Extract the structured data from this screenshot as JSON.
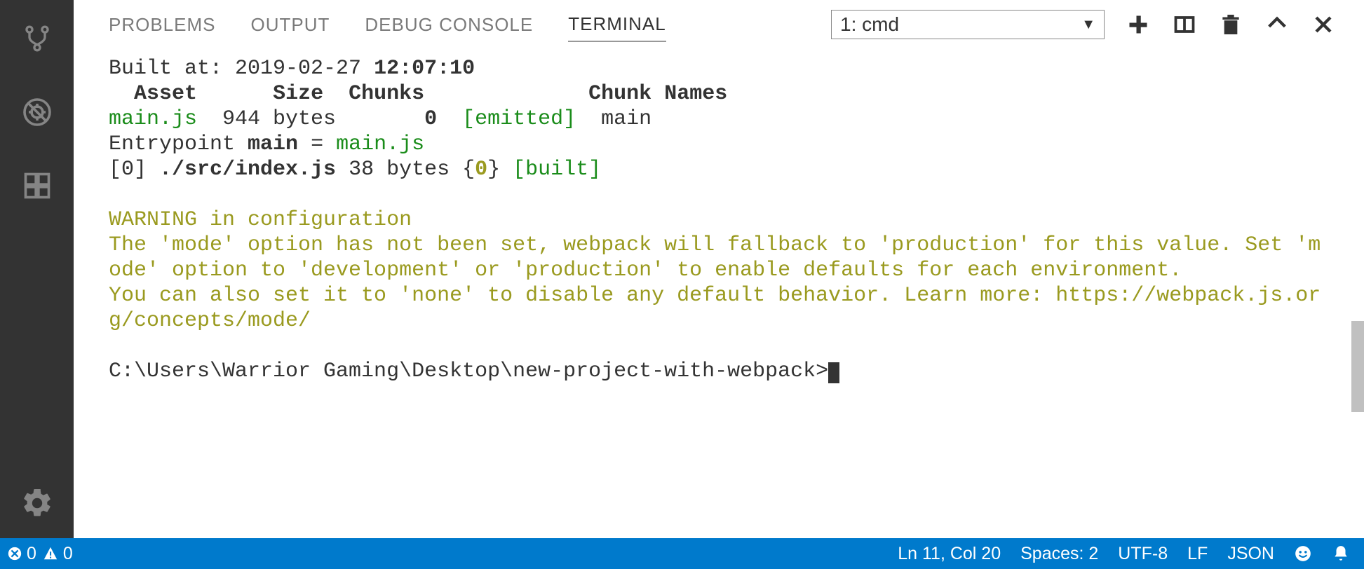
{
  "tabs": {
    "problems": "PROBLEMS",
    "output": "OUTPUT",
    "debug": "DEBUG CONSOLE",
    "terminal": "TERMINAL"
  },
  "terminalSelect": "1: cmd",
  "terminal": {
    "builtAtLabel": "Built at: 2019-02-27 ",
    "builtAtTime": "12:07:10",
    "headerAsset": "Asset",
    "headerSize": "Size",
    "headerChunks": "Chunks",
    "headerChunkNames": "Chunk Names",
    "assetName": "main.js",
    "assetSize": "  944 bytes       ",
    "assetChunk": "0",
    "assetEmitted": "[emitted]",
    "assetChunkName": "  main",
    "entryLabel": "Entrypoint ",
    "entryMain": "main",
    "entryEq": " = ",
    "entryFile": "main.js",
    "modIndex": "[0] ",
    "modFile": "./src/index.js",
    "modSize": " 38 bytes {",
    "modChunk": "0",
    "modCloseBrace": "} ",
    "modBuilt": "[built]",
    "warn1": "WARNING in configuration",
    "warn2": "The 'mode' option has not been set, webpack will fallback to 'production' for this value. Set 'mode' option to 'development' or 'production' to enable defaults for each environment.",
    "warn3": "You can also set it to 'none' to disable any default behavior. Learn more: https://webpack.js.org/concepts/mode/",
    "prompt": "C:\\Users\\Warrior Gaming\\Desktop\\new-project-with-webpack>"
  },
  "status": {
    "errors": "0",
    "warnings": "0",
    "lnCol": "Ln 11, Col 20",
    "spaces": "Spaces: 2",
    "encoding": "UTF-8",
    "eol": "LF",
    "lang": "JSON"
  }
}
